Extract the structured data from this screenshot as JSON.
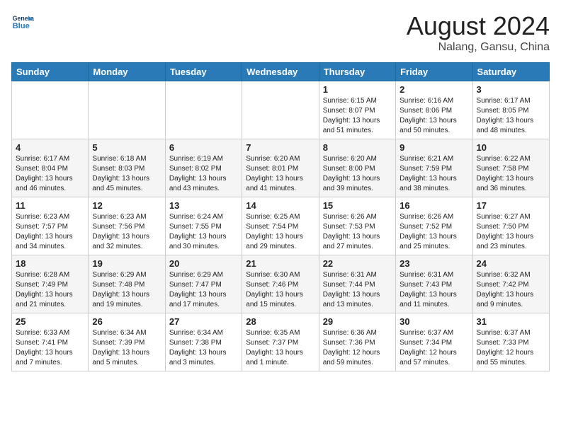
{
  "header": {
    "logo_line1": "General",
    "logo_line2": "Blue",
    "month_year": "August 2024",
    "location": "Nalang, Gansu, China"
  },
  "weekdays": [
    "Sunday",
    "Monday",
    "Tuesday",
    "Wednesday",
    "Thursday",
    "Friday",
    "Saturday"
  ],
  "weeks": [
    [
      {
        "day": "",
        "info": ""
      },
      {
        "day": "",
        "info": ""
      },
      {
        "day": "",
        "info": ""
      },
      {
        "day": "",
        "info": ""
      },
      {
        "day": "1",
        "info": "Sunrise: 6:15 AM\nSunset: 8:07 PM\nDaylight: 13 hours\nand 51 minutes."
      },
      {
        "day": "2",
        "info": "Sunrise: 6:16 AM\nSunset: 8:06 PM\nDaylight: 13 hours\nand 50 minutes."
      },
      {
        "day": "3",
        "info": "Sunrise: 6:17 AM\nSunset: 8:05 PM\nDaylight: 13 hours\nand 48 minutes."
      }
    ],
    [
      {
        "day": "4",
        "info": "Sunrise: 6:17 AM\nSunset: 8:04 PM\nDaylight: 13 hours\nand 46 minutes."
      },
      {
        "day": "5",
        "info": "Sunrise: 6:18 AM\nSunset: 8:03 PM\nDaylight: 13 hours\nand 45 minutes."
      },
      {
        "day": "6",
        "info": "Sunrise: 6:19 AM\nSunset: 8:02 PM\nDaylight: 13 hours\nand 43 minutes."
      },
      {
        "day": "7",
        "info": "Sunrise: 6:20 AM\nSunset: 8:01 PM\nDaylight: 13 hours\nand 41 minutes."
      },
      {
        "day": "8",
        "info": "Sunrise: 6:20 AM\nSunset: 8:00 PM\nDaylight: 13 hours\nand 39 minutes."
      },
      {
        "day": "9",
        "info": "Sunrise: 6:21 AM\nSunset: 7:59 PM\nDaylight: 13 hours\nand 38 minutes."
      },
      {
        "day": "10",
        "info": "Sunrise: 6:22 AM\nSunset: 7:58 PM\nDaylight: 13 hours\nand 36 minutes."
      }
    ],
    [
      {
        "day": "11",
        "info": "Sunrise: 6:23 AM\nSunset: 7:57 PM\nDaylight: 13 hours\nand 34 minutes."
      },
      {
        "day": "12",
        "info": "Sunrise: 6:23 AM\nSunset: 7:56 PM\nDaylight: 13 hours\nand 32 minutes."
      },
      {
        "day": "13",
        "info": "Sunrise: 6:24 AM\nSunset: 7:55 PM\nDaylight: 13 hours\nand 30 minutes."
      },
      {
        "day": "14",
        "info": "Sunrise: 6:25 AM\nSunset: 7:54 PM\nDaylight: 13 hours\nand 29 minutes."
      },
      {
        "day": "15",
        "info": "Sunrise: 6:26 AM\nSunset: 7:53 PM\nDaylight: 13 hours\nand 27 minutes."
      },
      {
        "day": "16",
        "info": "Sunrise: 6:26 AM\nSunset: 7:52 PM\nDaylight: 13 hours\nand 25 minutes."
      },
      {
        "day": "17",
        "info": "Sunrise: 6:27 AM\nSunset: 7:50 PM\nDaylight: 13 hours\nand 23 minutes."
      }
    ],
    [
      {
        "day": "18",
        "info": "Sunrise: 6:28 AM\nSunset: 7:49 PM\nDaylight: 13 hours\nand 21 minutes."
      },
      {
        "day": "19",
        "info": "Sunrise: 6:29 AM\nSunset: 7:48 PM\nDaylight: 13 hours\nand 19 minutes."
      },
      {
        "day": "20",
        "info": "Sunrise: 6:29 AM\nSunset: 7:47 PM\nDaylight: 13 hours\nand 17 minutes."
      },
      {
        "day": "21",
        "info": "Sunrise: 6:30 AM\nSunset: 7:46 PM\nDaylight: 13 hours\nand 15 minutes."
      },
      {
        "day": "22",
        "info": "Sunrise: 6:31 AM\nSunset: 7:44 PM\nDaylight: 13 hours\nand 13 minutes."
      },
      {
        "day": "23",
        "info": "Sunrise: 6:31 AM\nSunset: 7:43 PM\nDaylight: 13 hours\nand 11 minutes."
      },
      {
        "day": "24",
        "info": "Sunrise: 6:32 AM\nSunset: 7:42 PM\nDaylight: 13 hours\nand 9 minutes."
      }
    ],
    [
      {
        "day": "25",
        "info": "Sunrise: 6:33 AM\nSunset: 7:41 PM\nDaylight: 13 hours\nand 7 minutes."
      },
      {
        "day": "26",
        "info": "Sunrise: 6:34 AM\nSunset: 7:39 PM\nDaylight: 13 hours\nand 5 minutes."
      },
      {
        "day": "27",
        "info": "Sunrise: 6:34 AM\nSunset: 7:38 PM\nDaylight: 13 hours\nand 3 minutes."
      },
      {
        "day": "28",
        "info": "Sunrise: 6:35 AM\nSunset: 7:37 PM\nDaylight: 13 hours\nand 1 minute."
      },
      {
        "day": "29",
        "info": "Sunrise: 6:36 AM\nSunset: 7:36 PM\nDaylight: 12 hours\nand 59 minutes."
      },
      {
        "day": "30",
        "info": "Sunrise: 6:37 AM\nSunset: 7:34 PM\nDaylight: 12 hours\nand 57 minutes."
      },
      {
        "day": "31",
        "info": "Sunrise: 6:37 AM\nSunset: 7:33 PM\nDaylight: 12 hours\nand 55 minutes."
      }
    ]
  ]
}
